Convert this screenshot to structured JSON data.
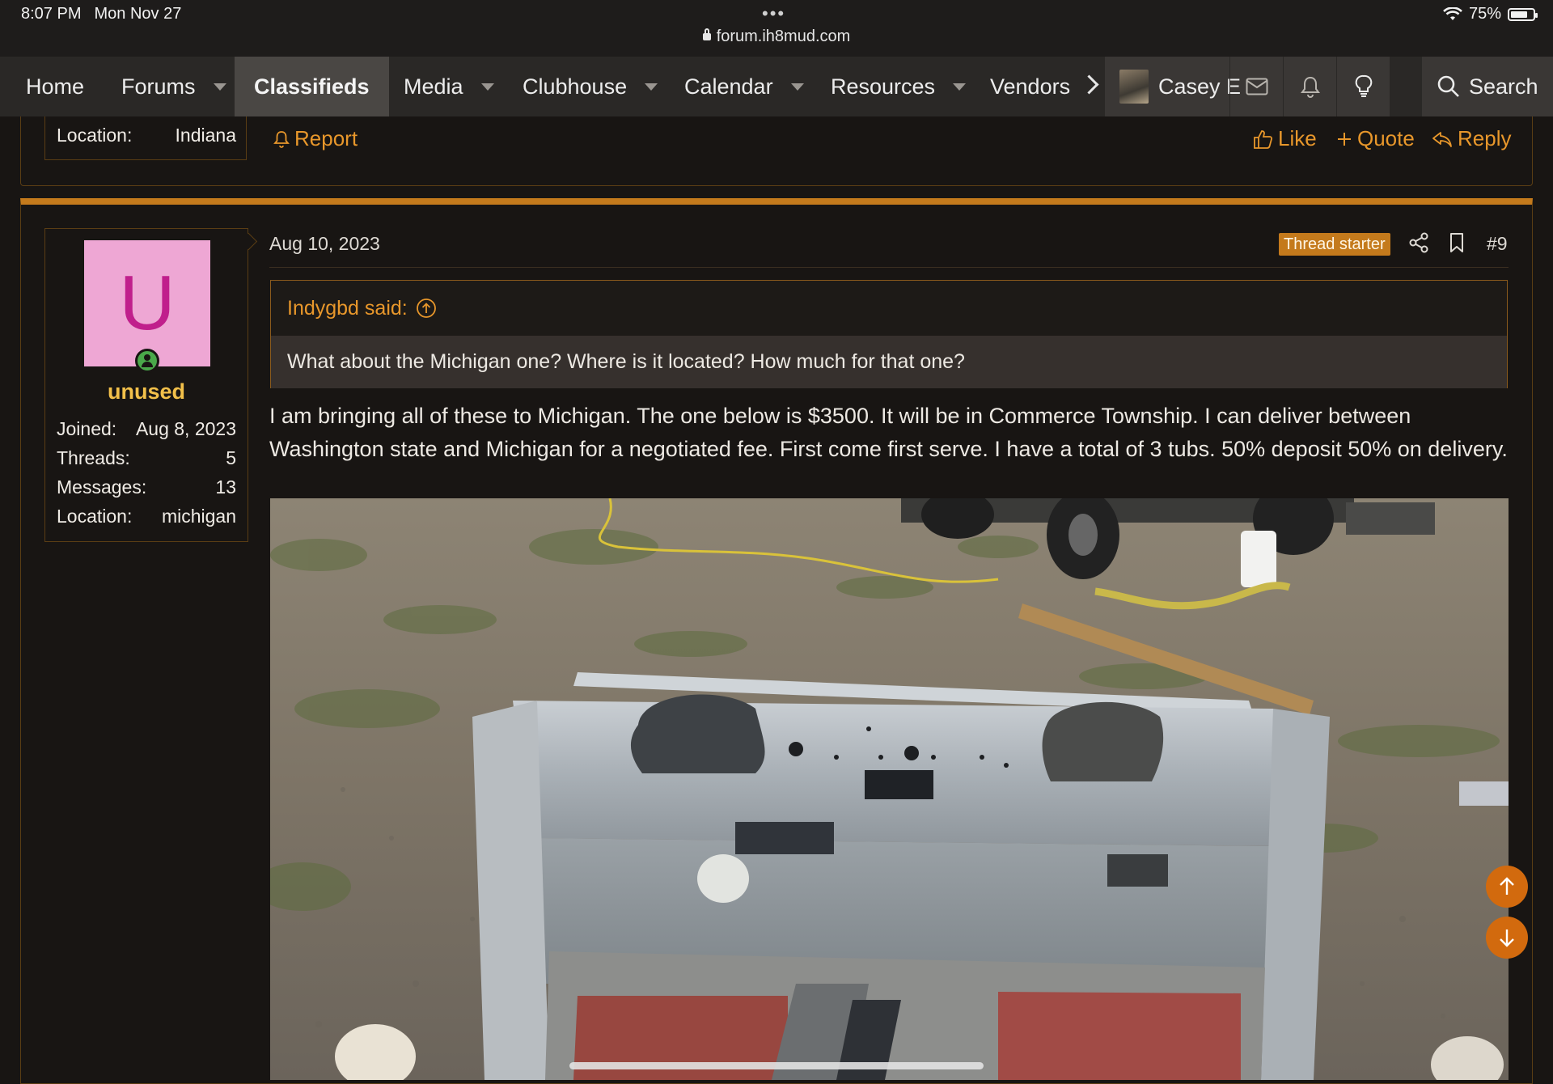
{
  "status_bar": {
    "time": "8:07 PM",
    "date": "Mon Nov 27",
    "url": "forum.ih8mud.com",
    "battery": "75%",
    "battery_level": 0.75
  },
  "nav": {
    "items": [
      {
        "label": "Home",
        "dropdown": false,
        "active": false
      },
      {
        "label": "Forums",
        "dropdown": true,
        "active": false
      },
      {
        "label": "Classifieds",
        "dropdown": false,
        "active": true
      },
      {
        "label": "Media",
        "dropdown": true,
        "active": false
      },
      {
        "label": "Clubhouse",
        "dropdown": true,
        "active": false
      },
      {
        "label": "Calendar",
        "dropdown": true,
        "active": false
      },
      {
        "label": "Resources",
        "dropdown": true,
        "active": false
      },
      {
        "label": "Vendors",
        "dropdown": false,
        "active": false
      }
    ],
    "user_name": "Casey E",
    "search_label": "Search",
    "icons": [
      "chevron-right-icon",
      "envelope-icon",
      "bell-icon",
      "lightbulb-icon",
      "search-icon"
    ]
  },
  "prev_post": {
    "location_label": "Location:",
    "location_value": "Indiana",
    "report_label": "Report",
    "like_label": "Like",
    "quote_label": "Quote",
    "reply_label": "Reply"
  },
  "post": {
    "date": "Aug 10, 2023",
    "badge": "Thread starter",
    "number": "#9",
    "user": {
      "avatar_letter": "U",
      "name": "unused",
      "stats": [
        {
          "label": "Joined:",
          "value": "Aug 8, 2023"
        },
        {
          "label": "Threads:",
          "value": "5"
        },
        {
          "label": "Messages:",
          "value": "13"
        },
        {
          "label": "Location:",
          "value": "michigan"
        }
      ]
    },
    "quote": {
      "attribution": "Indygbd said:",
      "text": "What about the Michigan one? Where is it located? How much for that one?"
    },
    "body": "I am bringing all of these to Michigan. The one below is $3500. It will be in Commerce Township. I can deliver between Washington state and Michigan for a negotiated fee. First come first serve. I have a total of 3 tubs. 50% deposit 50% on delivery."
  },
  "colors": {
    "accent": "#c47a1c",
    "link": "#e8972b",
    "username": "#f2c04a",
    "fab": "#d26a0e"
  }
}
